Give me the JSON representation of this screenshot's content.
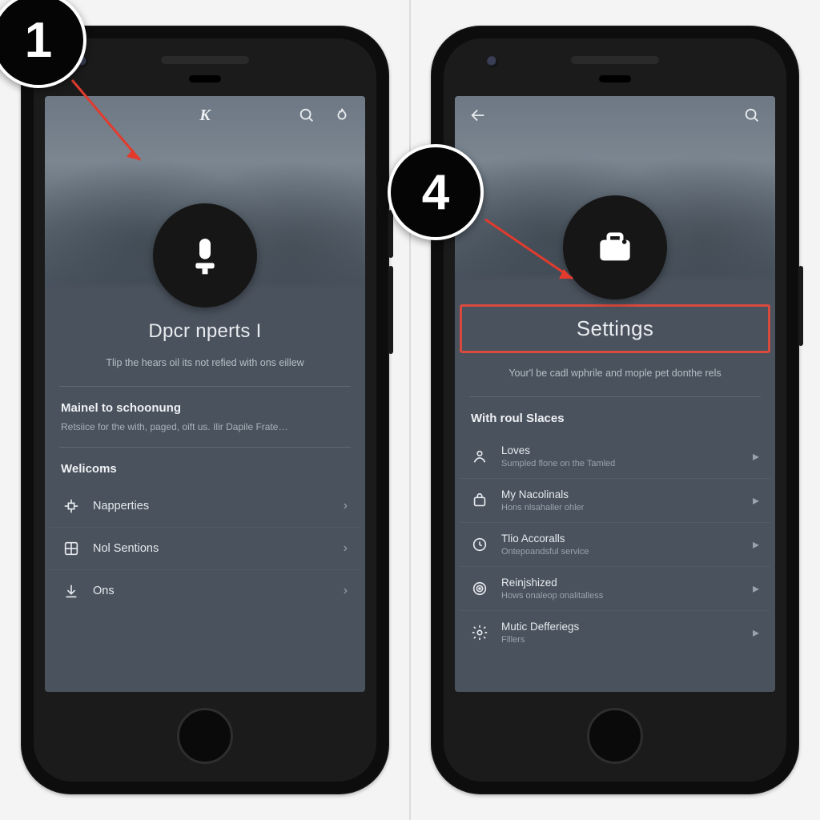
{
  "step_left": "1",
  "step_right": "4",
  "left": {
    "brand": "K",
    "avatar": "mic",
    "title": "Dpcr nperts I",
    "subtitle": "Tlip the hears oil its not refied with ons eillew",
    "section1": {
      "heading": "Mainel to schoonung",
      "sub": "Retsiice for the with, paged, oift us. Ilir Dapile Frate…"
    },
    "section2": "Welicoms",
    "rows": [
      {
        "icon": "widget",
        "label": "Napperties"
      },
      {
        "icon": "grid",
        "label": "Nol Sentions"
      },
      {
        "icon": "download",
        "label": "Ons"
      }
    ]
  },
  "right": {
    "avatar": "briefcase",
    "title": "Settings",
    "subtitle": "Your'l be cadl wphrile and mople pet donthe rels",
    "section": "With roul Slaces",
    "rows": [
      {
        "icon": "person",
        "label": "Loves",
        "desc": "Sumpled flone on the Tamled"
      },
      {
        "icon": "bag",
        "label": "My Nacolinals",
        "desc": "Hons nlsahaller ohler"
      },
      {
        "icon": "clock",
        "label": "Tlio Accoralls",
        "desc": "Ontepoandsful service"
      },
      {
        "icon": "target",
        "label": "Reinjshized",
        "desc": "Hows onaleop onalitalless"
      },
      {
        "icon": "gear",
        "label": "Mutic Defferiegs",
        "desc": "Flllers"
      },
      {
        "icon": "",
        "label": "",
        "desc": ""
      }
    ]
  }
}
